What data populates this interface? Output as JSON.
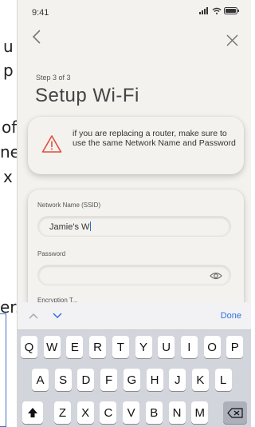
{
  "background": {
    "fragments": [
      "u",
      "p",
      "of",
      "ne",
      "x",
      "er."
    ]
  },
  "status_bar": {
    "time": "9:41"
  },
  "nav": {
    "back_icon": "chevron-left-icon",
    "close_icon": "close-icon"
  },
  "step": "Step 3 of 3",
  "title": "Setup Wi-Fi",
  "warning": {
    "icon": "warning-icon",
    "text": "if you are replacing a router, make sure to use the same Network Name and Password",
    "accent": "#e0503a"
  },
  "form": {
    "network_label": "Network Name (SSID)",
    "network_value": "Jamie's W",
    "password_label": "Password",
    "password_value": "",
    "encryption_label": "Encryption T..."
  },
  "keyboard": {
    "done_label": "Done",
    "done_color": "#2f6fe0",
    "row1": [
      "Q",
      "W",
      "E",
      "R",
      "T",
      "Y",
      "U",
      "I",
      "O",
      "P"
    ],
    "row2": [
      "A",
      "S",
      "D",
      "F",
      "G",
      "H",
      "J",
      "K",
      "L"
    ],
    "row3": [
      "Z",
      "X",
      "C",
      "V",
      "B",
      "N",
      "M"
    ]
  }
}
